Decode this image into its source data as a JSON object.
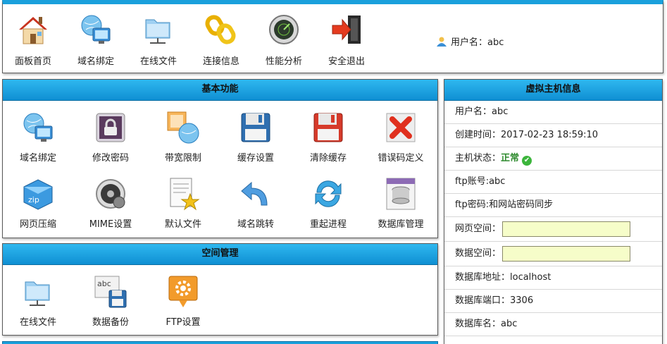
{
  "top_nav": {
    "items": [
      {
        "label": "面板首页",
        "icon": "home-icon"
      },
      {
        "label": "域名绑定",
        "icon": "globe-monitor-icon"
      },
      {
        "label": "在线文件",
        "icon": "folder-network-icon"
      },
      {
        "label": "连接信息",
        "icon": "chain-link-icon"
      },
      {
        "label": "性能分析",
        "icon": "radar-gauge-icon"
      },
      {
        "label": "安全退出",
        "icon": "exit-door-icon"
      }
    ],
    "user_label": "用户名：abc"
  },
  "basic_functions": {
    "title": "基本功能",
    "items": [
      {
        "label": "域名绑定",
        "icon": "globe-monitor-icon"
      },
      {
        "label": "修改密码",
        "icon": "lock-icon"
      },
      {
        "label": "带宽限制",
        "icon": "bandwidth-globe-icon"
      },
      {
        "label": "缓存设置",
        "icon": "floppy-disk-icon"
      },
      {
        "label": "清除缓存",
        "icon": "floppy-disk-red-icon"
      },
      {
        "label": "错误码定义",
        "icon": "red-x-icon"
      },
      {
        "label": "网页压缩",
        "icon": "zip-box-icon"
      },
      {
        "label": "MIME设置",
        "icon": "gear-disc-icon"
      },
      {
        "label": "默认文件",
        "icon": "document-star-icon"
      },
      {
        "label": "域名跳转",
        "icon": "redirect-arrow-icon"
      },
      {
        "label": "重起进程",
        "icon": "refresh-icon"
      },
      {
        "label": "数据库管理",
        "icon": "database-icon"
      }
    ]
  },
  "space_management": {
    "title": "空间管理",
    "items": [
      {
        "label": "在线文件",
        "icon": "folder-network-icon"
      },
      {
        "label": "数据备份",
        "icon": "backup-disk-icon"
      },
      {
        "label": "FTP设置",
        "icon": "ftp-gear-icon"
      }
    ]
  },
  "host_info": {
    "title": "虚拟主机信息",
    "username": "用户名：abc",
    "created": "创建时间：2017-02-23 18:59:10",
    "status_label": "主机状态：",
    "status_value": "正常",
    "ftp_account": "ftp账号:abc",
    "ftp_password": "ftp密码:和网站密码同步",
    "web_space_label": "网页空间：",
    "data_space_label": "数据空间：",
    "db_address": "数据库地址：localhost",
    "db_port": "数据库端口：3306",
    "db_name": "数据库名：abc"
  },
  "colors": {
    "header_blue": "#1aa0dc",
    "quota_fill": "#f6fdc9",
    "status_green": "#2e8b2e"
  }
}
